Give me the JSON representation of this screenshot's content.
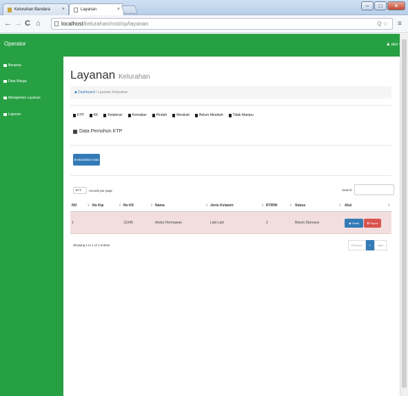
{
  "browser": {
    "tabs": [
      {
        "label": "Kelurahan Bandara"
      },
      {
        "label": "Layanan"
      }
    ],
    "url_host": "localhost",
    "url_path": "/kelurahan/root/op/layanan"
  },
  "app": {
    "brand": "Operator",
    "user": "eko",
    "sidebar": [
      {
        "label": "Beranda"
      },
      {
        "label": "Data Warga"
      },
      {
        "label": "Manajemen Layanan"
      },
      {
        "label": "Laporan"
      }
    ]
  },
  "page": {
    "title": "Layanan",
    "subtitle": "Kelurahan",
    "breadcrumb_home": "Dashboard",
    "breadcrumb_current": "Layanan Kelurahan"
  },
  "service_tabs": [
    "KTP",
    "KK",
    "Kelahiran",
    "Kematian",
    "Pindah",
    "Menikah",
    "Belum Menikah",
    "Tidak Mampu"
  ],
  "section_title": "Data Pemohon KTP",
  "add_button": "Masukkan Data",
  "length": {
    "value": "10",
    "label": "records per page"
  },
  "search_label": "Search:",
  "table": {
    "headers": [
      "NO",
      "No Ktp",
      "No KK",
      "Nama",
      "Jenis Kelamin",
      "RT/RW",
      "Status",
      "Aksi"
    ],
    "rows": [
      {
        "no": "1",
        "no_ktp": "",
        "no_kk": "12345",
        "nama": "Andra Hermawan",
        "jenis_kelamin": "Laki-Laki",
        "rtrw": "2",
        "status": "Belum Diproses"
      }
    ],
    "detail_label": "Detail",
    "hapus_label": "Hapus"
  },
  "info": "Showing 1 to 1 of 1 entries",
  "pagination": {
    "previous": "Previous",
    "current": "1",
    "next": "Next"
  }
}
